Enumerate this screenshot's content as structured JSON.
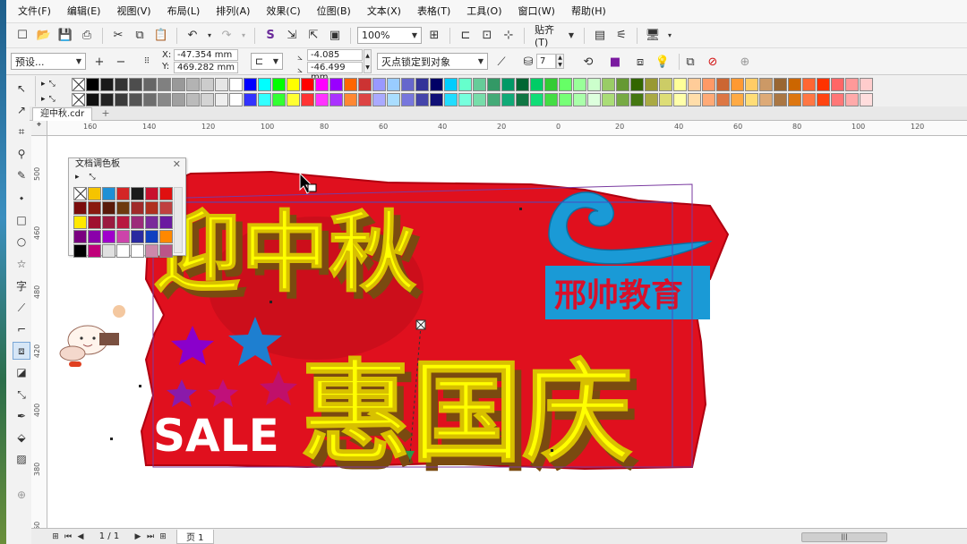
{
  "menu": [
    "文件(F)",
    "编辑(E)",
    "视图(V)",
    "布局(L)",
    "排列(A)",
    "效果(C)",
    "位图(B)",
    "文本(X)",
    "表格(T)",
    "工具(O)",
    "窗口(W)",
    "帮助(H)"
  ],
  "toolbar": {
    "zoom": "100%",
    "snap": "贴齐(T)"
  },
  "propbar": {
    "preset": "预设...",
    "x_label": "X:",
    "x_value": "-47.354 mm",
    "y_label": "Y:",
    "y_value": "469.282 mm",
    "vp_x": "-4.085 mm",
    "vp_y": "-46.499 mm",
    "vanish_mode": "灭点锁定到对象",
    "depth": "7"
  },
  "document": {
    "tab_name": "迎中秋.cdr",
    "page_label": "页 1",
    "page_count": "1 / 1"
  },
  "docker": {
    "title": "文档调色板",
    "colors": [
      "none",
      "#f5c400",
      "#1e90d6",
      "#d42525",
      "#1a1a1a",
      "#c8102e",
      "#e01010",
      "#7a0c0c",
      "#8a1a10",
      "#5a1a0a",
      "#6e3a10",
      "#a02a2a",
      "#b03020",
      "#c04040",
      "#ffe800",
      "#a01030",
      "#9a1a40",
      "#b81840",
      "#9c2a7a",
      "#7a2a9a",
      "#6a1aa0",
      "#7a0080",
      "#8a00aa",
      "#a000cc",
      "#cc44aa",
      "#2a2aa0",
      "#1040c0",
      "#ff8800",
      "#000000",
      "#c0007a",
      "#e0e0e0",
      "#ffffff",
      "#ffffff",
      "#cc88aa",
      "#bb5588"
    ]
  },
  "artwork": {
    "line1": "迎中秋",
    "line2": "惠国庆",
    "sale": "SALE",
    "brand": "邢帅教育",
    "colors": {
      "yellow": "#ffff00",
      "red": "#e0101e",
      "shadow": "#7a4a10",
      "brand_blue": "#1a9ad6",
      "brand_text": "#d8102a"
    }
  },
  "ruler": {
    "h_ticks": [
      "160",
      "140",
      "120",
      "100",
      "80",
      "60",
      "40",
      "20",
      "0",
      "20",
      "40",
      "60",
      "80",
      "100",
      "120"
    ],
    "v_ticks": [
      "500",
      "460",
      "480",
      "420",
      "400",
      "380",
      "360"
    ]
  }
}
